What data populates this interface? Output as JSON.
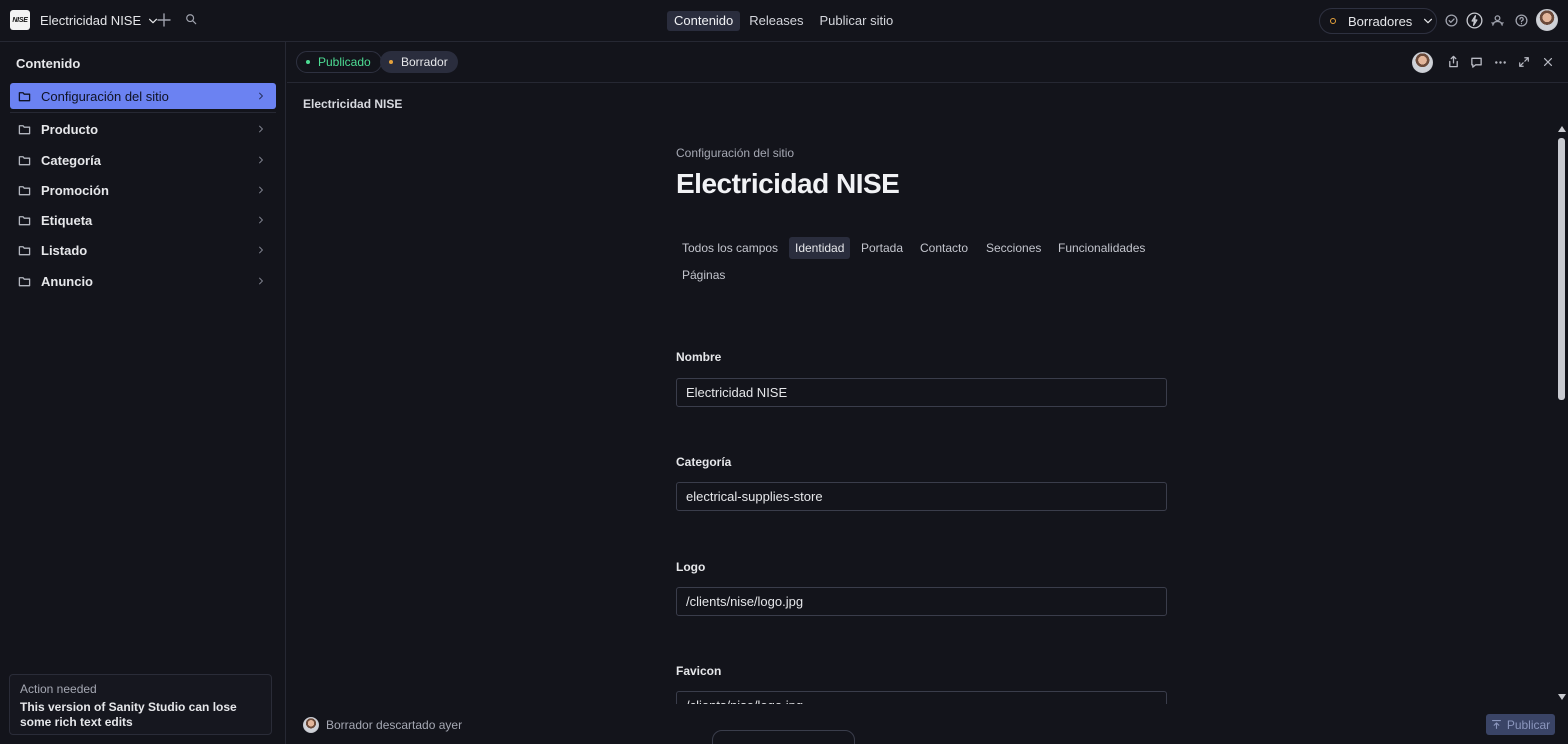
{
  "topbar": {
    "logo_text": "NISE",
    "workspace_name": "Electricidad NISE",
    "nav": [
      "Contenido",
      "Releases",
      "Publicar sitio"
    ],
    "perspective": "Borradores",
    "icons": [
      "chevron-down-icon",
      "plus-icon",
      "search-icon",
      "check-circle-icon",
      "lightning-icon",
      "users-icon",
      "help-icon",
      "avatar"
    ]
  },
  "sidebar": {
    "title": "Contenido",
    "items": [
      {
        "label": "Configuración del sitio",
        "active": true
      },
      {
        "label": "Producto"
      },
      {
        "label": "Categoría"
      },
      {
        "label": "Promoción"
      },
      {
        "label": "Etiqueta"
      },
      {
        "label": "Listado"
      },
      {
        "label": "Anuncio"
      }
    ],
    "notice": {
      "title": "Action needed",
      "body": "This version of Sanity Studio can lose some rich text edits"
    }
  },
  "pane": {
    "status_published": "Publicado",
    "status_draft": "Borrador",
    "breadcrumb_title": "Electricidad NISE",
    "doc_type": "Configuración del sitio",
    "doc_title": "Electricidad NISE",
    "tabs": [
      "Todos los campos",
      "Identidad",
      "Portada",
      "Contacto",
      "Secciones",
      "Funcionalidades",
      "Páginas"
    ],
    "active_tab": "Identidad",
    "fields": [
      {
        "label": "Nombre",
        "value": "Electricidad NISE"
      },
      {
        "label": "Categoría",
        "value": "electrical-supplies-store"
      },
      {
        "label": "Logo",
        "value": "/clients/nise/logo.jpg"
      },
      {
        "label": "Favicon",
        "value": "/clients/nise/logo.jpg"
      }
    ]
  },
  "footer": {
    "status": "Borrador descartado ayer",
    "publish_label": "Publicar"
  },
  "colors": {
    "background": "#13141b",
    "accent": "#6b82f2",
    "published": "#4ddc93",
    "draft": "#e6a23c"
  }
}
